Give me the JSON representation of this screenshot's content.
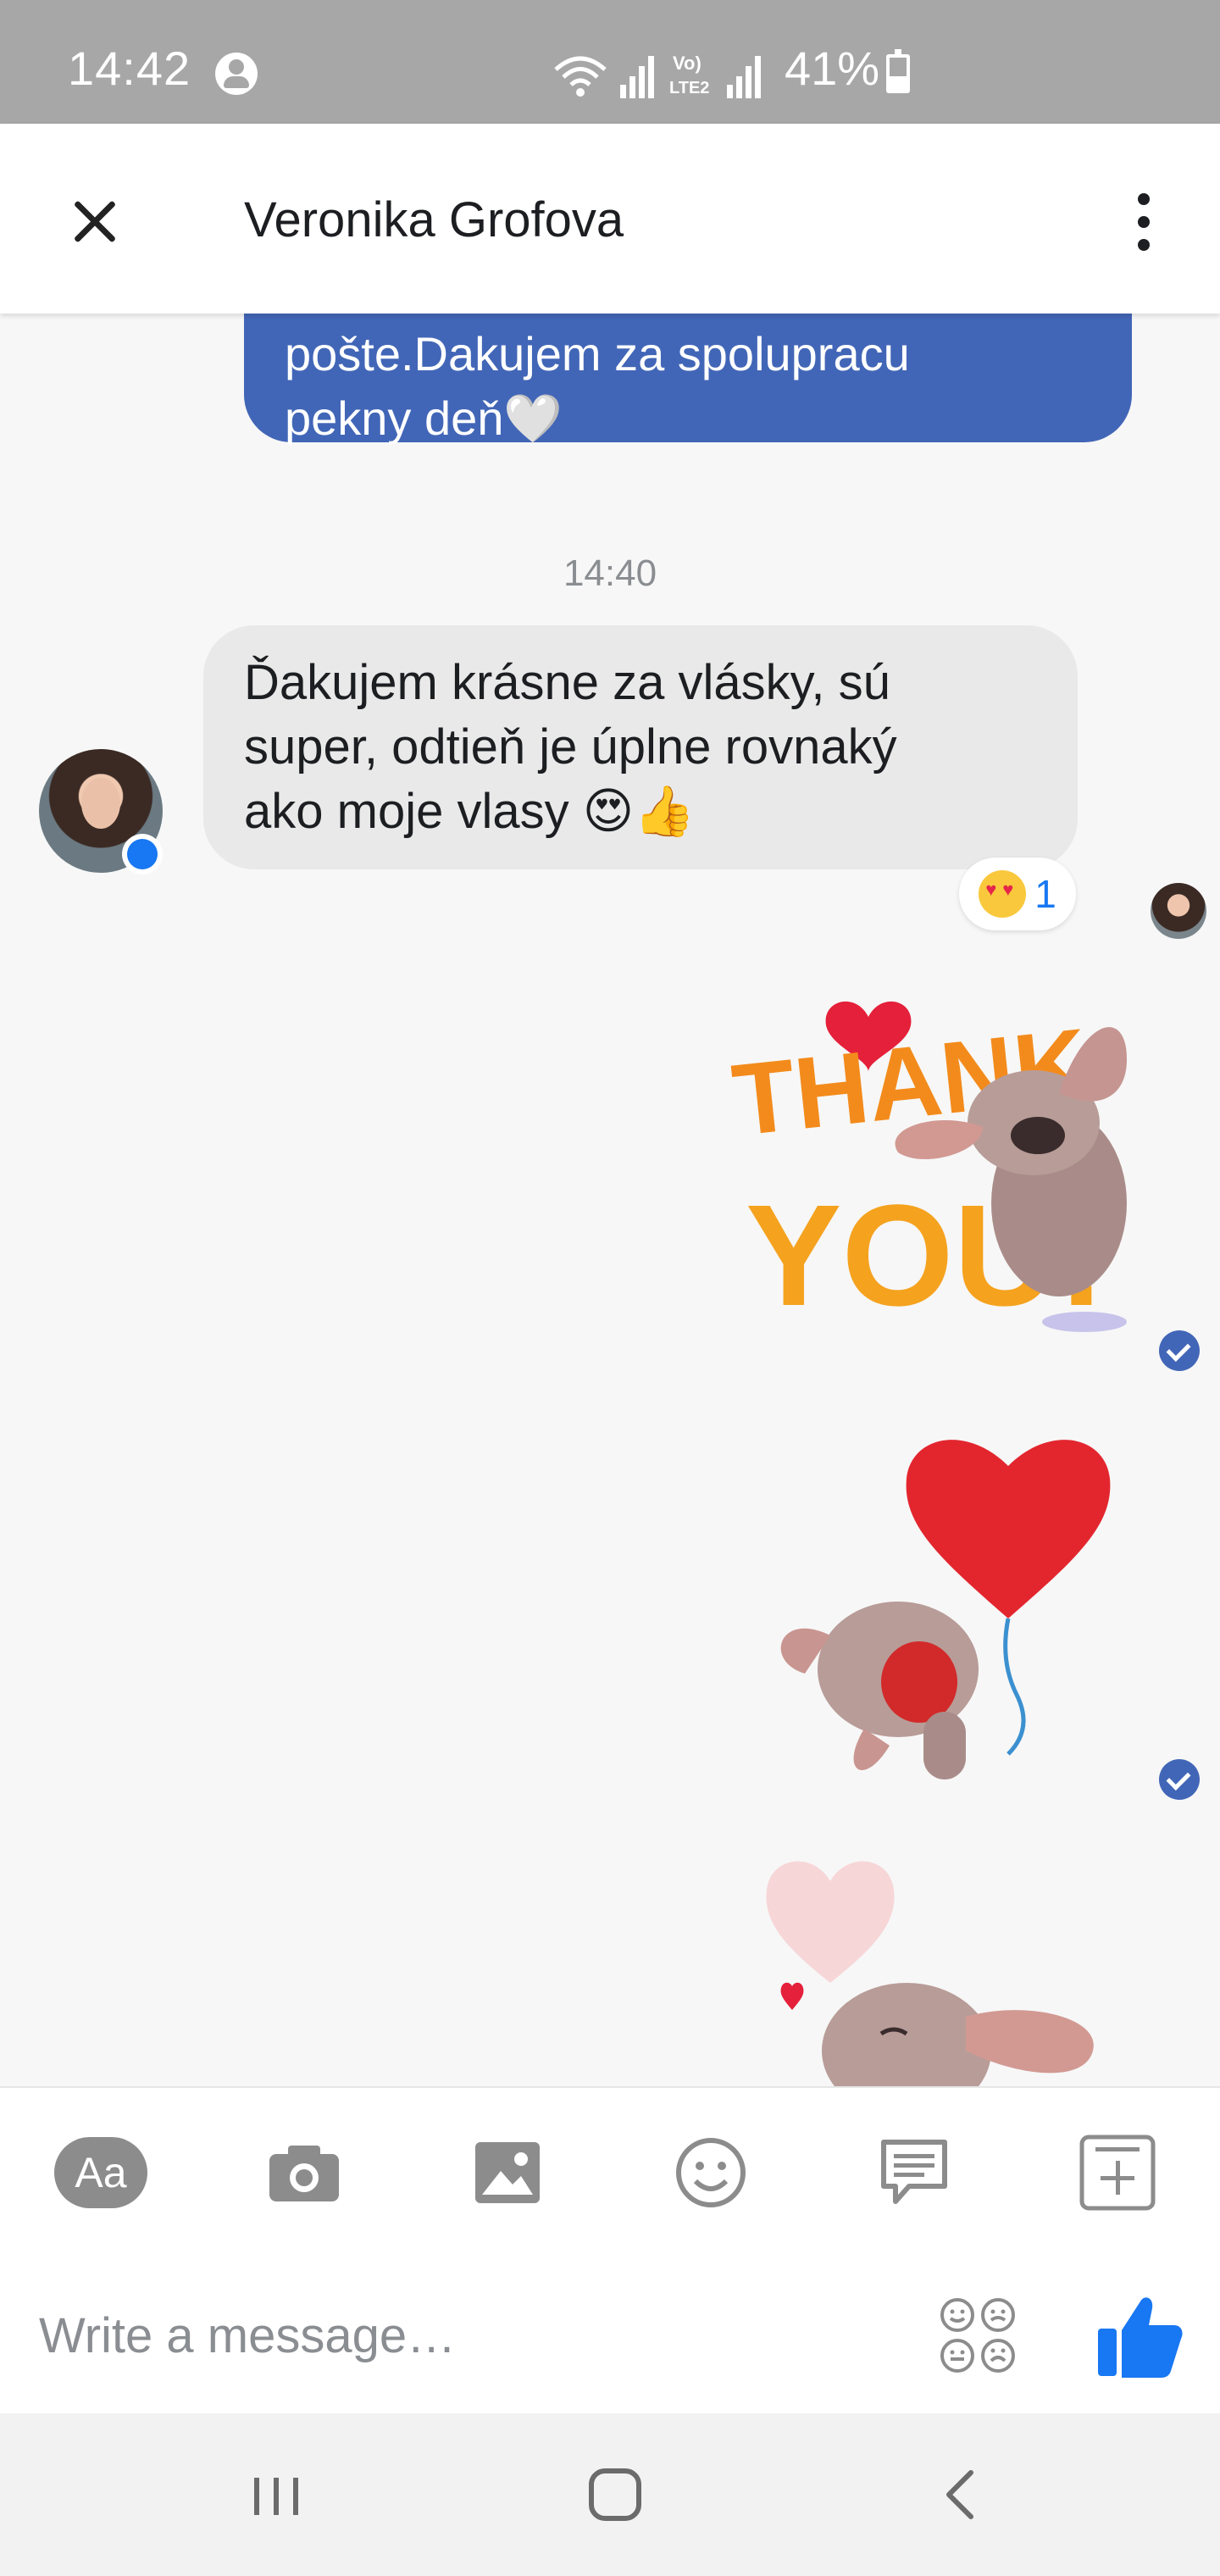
{
  "status_bar": {
    "time": "14:42",
    "battery_percent": "41%",
    "battery_level": 0.41,
    "icons": [
      "user-icon",
      "wifi-icon",
      "signal-icon",
      "volte-lte2-icon",
      "signal-icon-2",
      "battery-icon"
    ]
  },
  "header": {
    "contact_name": "Veronika Grofova",
    "close_icon": "close-icon",
    "more_icon": "more-vert-icon"
  },
  "chat": {
    "outgoing_message": {
      "lines": [
        "pošte.Dakujem za spolupracu",
        "pekny deň🤍"
      ]
    },
    "timestamp": "14:40",
    "incoming_message": {
      "lines": [
        "Ďakujem krásne za vlásky, sú",
        "super, odtieň je úplne rovnaký",
        "ako moje vlasy 😍👍"
      ]
    },
    "reaction": {
      "emoji": "heart-eyes-emoji",
      "count": "1"
    },
    "stickers": [
      {
        "name": "thank-you-sticker",
        "text_line1": "THANK",
        "text_line2": "YOU!"
      },
      {
        "name": "heart-balloon-sticker"
      },
      {
        "name": "heart-kiss-sticker"
      }
    ]
  },
  "composer": {
    "tools": [
      {
        "label": "Aa",
        "icon": "text-icon"
      },
      {
        "icon": "camera-icon"
      },
      {
        "icon": "gallery-icon"
      },
      {
        "icon": "smiley-icon"
      },
      {
        "icon": "chat-quote-icon"
      },
      {
        "icon": "plus-square-icon"
      }
    ],
    "placeholder": "Write a message…",
    "like_icon": "thumbs-up-icon"
  },
  "navigation": {
    "icons": [
      "recent-apps-icon",
      "home-icon",
      "back-icon"
    ]
  },
  "colors": {
    "status_bar": "#a7a7a7",
    "outgoing_bubble": "#4266b7",
    "incoming_bubble": "#e9e9e9",
    "accent": "#1877f2"
  }
}
